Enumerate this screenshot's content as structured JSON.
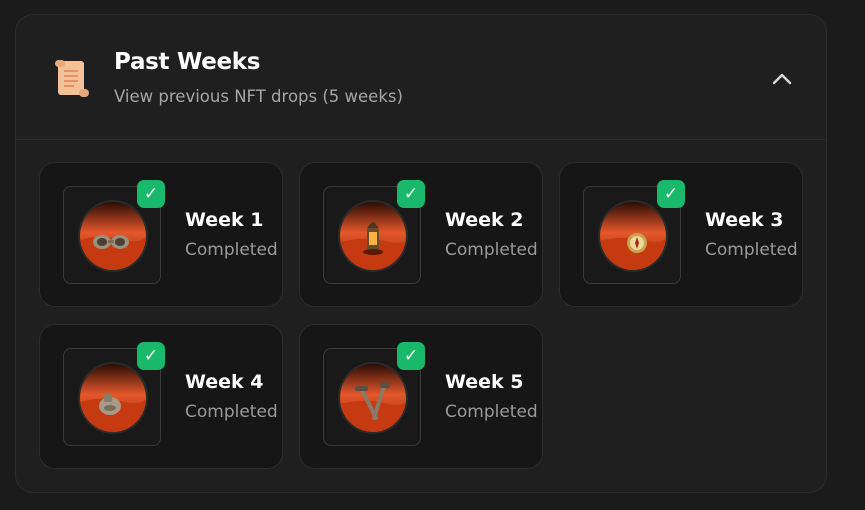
{
  "header": {
    "title": "Past Weeks",
    "subtitle": "View previous NFT drops (5 weeks)",
    "icon": "scroll-icon",
    "toggle_icon": "chevron-up-icon"
  },
  "weeks": [
    {
      "label": "Week 1",
      "status": "Completed",
      "artwork": "goggles",
      "completed": true
    },
    {
      "label": "Week 2",
      "status": "Completed",
      "artwork": "lantern",
      "completed": true
    },
    {
      "label": "Week 3",
      "status": "Completed",
      "artwork": "compass",
      "completed": true
    },
    {
      "label": "Week 4",
      "status": "Completed",
      "artwork": "water-flask",
      "completed": true
    },
    {
      "label": "Week 5",
      "status": "Completed",
      "artwork": "crossed-tools",
      "completed": true
    }
  ],
  "badge": {
    "symbol": "✓",
    "color": "#19b86a"
  },
  "colors": {
    "background": "#1b1b1b",
    "panel": "#1f1f1f",
    "card": "#161616",
    "desert": "#c93a10"
  }
}
